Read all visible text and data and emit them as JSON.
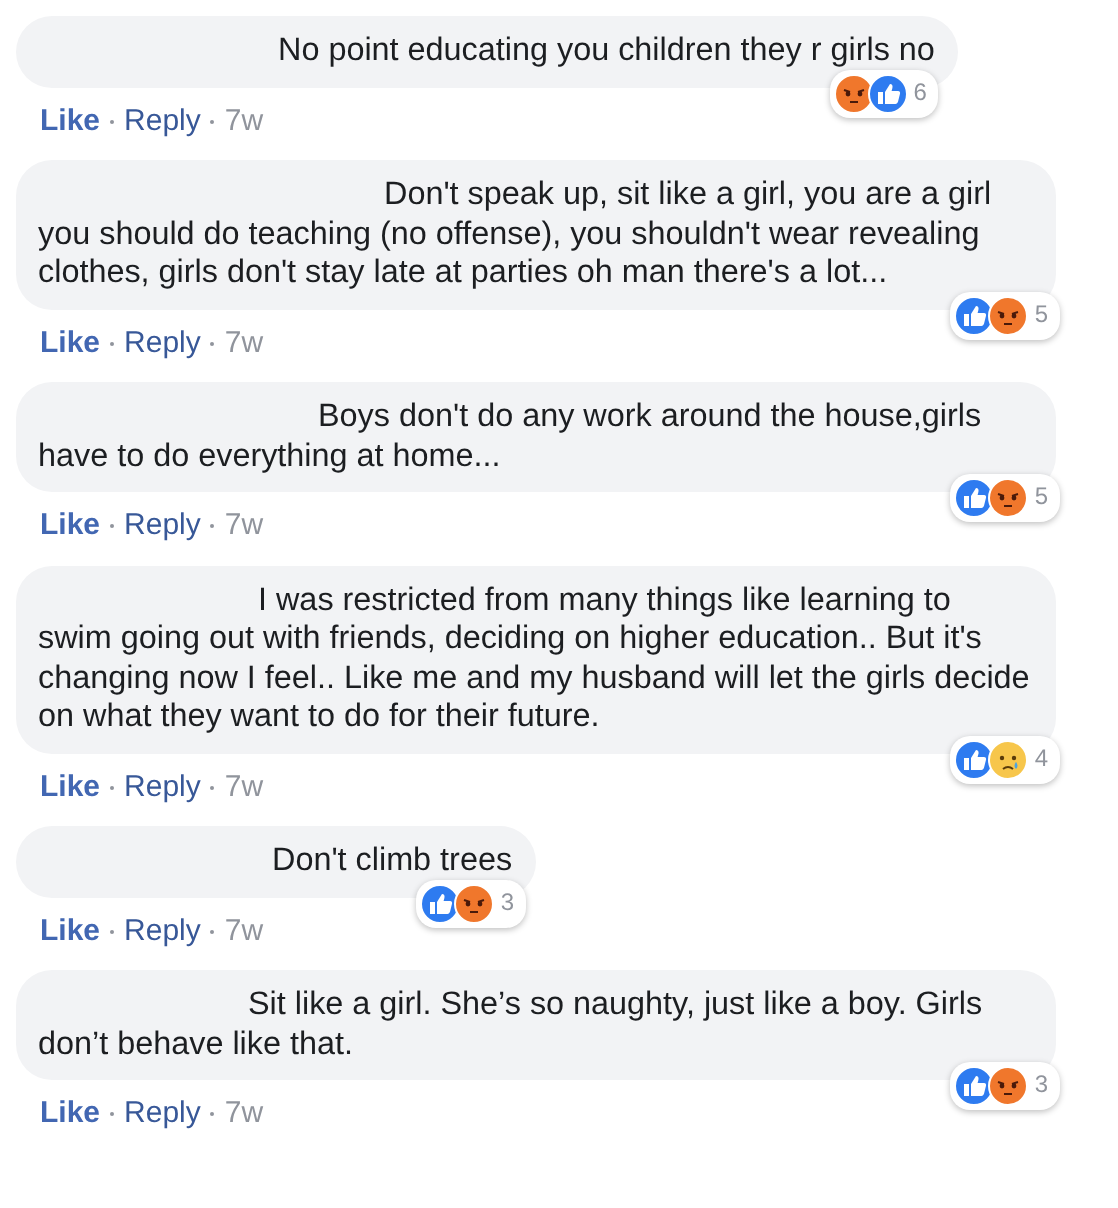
{
  "comments": [
    {
      "text": "No point educating you children they r girls no",
      "actions": {
        "like": "Like",
        "reply": "Reply",
        "time": "7w"
      },
      "reactions": {
        "icons": [
          {
            "kind": "angry"
          },
          {
            "kind": "like"
          }
        ],
        "count": "6"
      }
    },
    {
      "text": "Don't speak up, sit like a girl, you are a girl you should do teaching (no offense), you shouldn't wear revealing clothes, girls don't stay late at parties oh man there's a lot...",
      "actions": {
        "like": "Like",
        "reply": "Reply",
        "time": "7w"
      },
      "reactions": {
        "icons": [
          {
            "kind": "like"
          },
          {
            "kind": "angry"
          }
        ],
        "count": "5"
      }
    },
    {
      "text": "Boys don't do any work around the house,girls have to do everything at home...",
      "actions": {
        "like": "Like",
        "reply": "Reply",
        "time": "7w"
      },
      "reactions": {
        "icons": [
          {
            "kind": "like"
          },
          {
            "kind": "angry"
          }
        ],
        "count": "5"
      }
    },
    {
      "text": "I was restricted from many things like learning to swim going out with friends, deciding on higher education.. But it's changing now I feel.. Like me and my husband will let the girls decide on what they want to do for their future.",
      "actions": {
        "like": "Like",
        "reply": "Reply",
        "time": "7w"
      },
      "reactions": {
        "icons": [
          {
            "kind": "like"
          },
          {
            "kind": "sad"
          }
        ],
        "count": "4"
      }
    },
    {
      "text": "Don't climb trees",
      "actions": {
        "like": "Like",
        "reply": "Reply",
        "time": "7w"
      },
      "reactions": {
        "icons": [
          {
            "kind": "like"
          },
          {
            "kind": "angry"
          }
        ],
        "count": "3"
      }
    },
    {
      "text": "Sit like a girl. She’s so naughty, just like a boy. Girls don’t behave like that.",
      "actions": {
        "like": "Like",
        "reply": "Reply",
        "time": "7w"
      },
      "reactions": {
        "icons": [
          {
            "kind": "like"
          },
          {
            "kind": "angry"
          }
        ],
        "count": "3"
      }
    }
  ]
}
